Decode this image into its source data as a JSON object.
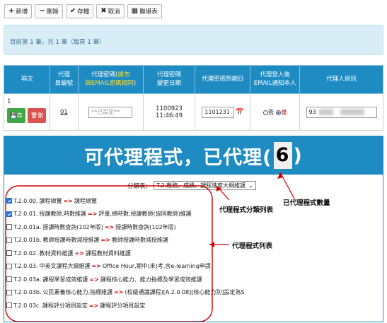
{
  "toolbar": {
    "add": "新增",
    "delete": "刪除",
    "save": "存檔",
    "cancel": "取消",
    "report": "聯堪表"
  },
  "info": {
    "text": "目前第 1 筆，共 1 筆（每頁 1 筆）"
  },
  "table": {
    "headers": {
      "seq": "項次",
      "code_l1": "代理",
      "code_l2": "員編號",
      "pwd_l1": "代理密碼(",
      "pwd_hint_a": "請勿",
      "pwd_hint_b": "與EMAIL密碼相同",
      "pwd_l2_end": ")",
      "change_l1": "代理密碼",
      "change_l2": "變更日期",
      "expire": "代理密碼到期日",
      "notify_l1": "代理登入後",
      "notify_l2": "EMAIL通知本人",
      "agent_info": "代理人資訊"
    },
    "row": {
      "seq": "1",
      "save_btn": "存",
      "del_btn": "刪",
      "code": "01",
      "pwd_placeholder": "**已設定**",
      "change_date": "1100923 11:46:49",
      "expire_value": "1101231",
      "notify_no": "否",
      "notify_yes": "是",
      "agent_prefix": "93"
    }
  },
  "program": {
    "title_a": "可代理程式，已代理(",
    "count": "6",
    "title_b": ")",
    "category_label": "分類表：",
    "category_value": "T.2.教務、成績、課程進度大綱維護",
    "items": [
      {
        "checked": true,
        "code": "T.2.0.00.",
        "text": "課程總覽",
        "arrow": "=>",
        "tail": "課程總覽"
      },
      {
        "checked": true,
        "code": "T.2.0.01.",
        "text": "授課教師,時數維護",
        "arrow": "=>",
        "tail": "評量,總時數,授課教師(協同教師)維護"
      },
      {
        "checked": false,
        "code": "T.2.0.01a.",
        "text": "授課時數查詢(102年版)",
        "arrow": "=>",
        "tail": "授課時數查詢(102年版)"
      },
      {
        "checked": false,
        "code": "T.2.0.01b.",
        "text": "教師授課時數減授維護",
        "arrow": "=>",
        "tail": "教師授課時數減授維護"
      },
      {
        "checked": false,
        "code": "T.2.0.02.",
        "text": "教材資料維護",
        "arrow": "=>",
        "tail": "課程教材資料維護"
      },
      {
        "checked": false,
        "code": "T.2.0.03.",
        "text": "中英文課程大綱維護",
        "arrow": "=>",
        "tail": "Office Hour,期中(末)考,含e-learning申請"
      },
      {
        "checked": false,
        "code": "T.2.0.03a.",
        "text": "課程學習成效維護",
        "arrow": "=>",
        "tail": "課程核心能力、能力指標及學習成效維護"
      },
      {
        "checked": false,
        "code": "T.2.0.03b.",
        "text": "公民素養核心能力,指標維護",
        "arrow": "=>",
        "tail": "(校級通識課程)[A.2.0.08][核心能力別]設定為S"
      },
      {
        "checked": false,
        "code": "T.2.0.03c.",
        "text": "課程評分項目設定",
        "arrow": "=>",
        "tail": "課程評分項目設定"
      }
    ]
  },
  "annotations": {
    "count_label": "已代理程式數量",
    "category_label": "代理程式分類列表",
    "list_label": "代理程式列表"
  },
  "colors": {
    "header_blue": "#1e8bc3",
    "info_bg": "#d9edf7",
    "annotation_red": "#d00000"
  }
}
